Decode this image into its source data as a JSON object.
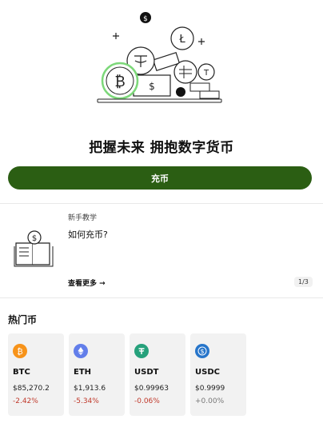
{
  "hero": {
    "headline": "把握未来 拥抱数字货币"
  },
  "deposit_button": {
    "label": "充币"
  },
  "tutorial": {
    "label": "新手教学",
    "title": "如何充币?",
    "more": "查看更多 →",
    "pager": "1/3"
  },
  "hot_coins": {
    "title": "热门币",
    "items": [
      {
        "symbol": "BTC",
        "price": "$85,270.2",
        "change": "-2.42%",
        "icon": "bitcoin-icon",
        "color": "#f7931a",
        "change_color": "#c0392b"
      },
      {
        "symbol": "ETH",
        "price": "$1,913.6",
        "change": "-5.34%",
        "icon": "ethereum-icon",
        "color": "#627eea",
        "change_color": "#c0392b"
      },
      {
        "symbol": "USDT",
        "price": "$0.99963",
        "change": "-0.06%",
        "icon": "tether-icon",
        "color": "#26a17b",
        "change_color": "#c0392b"
      },
      {
        "symbol": "USDC",
        "price": "$0.9999",
        "change": "+0.00%",
        "icon": "usdc-icon",
        "color": "#2775ca",
        "change_color": "#777777"
      }
    ]
  },
  "colors": {
    "accent": "#2b5e13",
    "negative": "#c0392b",
    "neutral": "#777777"
  }
}
